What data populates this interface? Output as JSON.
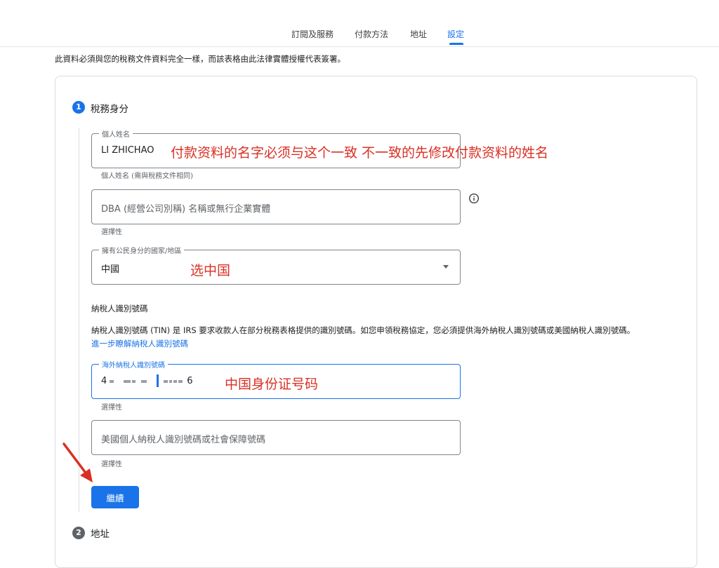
{
  "nav": {
    "tabs": [
      {
        "label": "訂閱及服務"
      },
      {
        "label": "付款方法"
      },
      {
        "label": "地址"
      },
      {
        "label": "設定"
      }
    ],
    "active_tab": "設定"
  },
  "notice": "此資料必須與您的稅務文件資料完全一樣，而該表格由此法律實體授權代表簽署。",
  "steps": [
    {
      "number": "1",
      "title": "稅務身分"
    },
    {
      "number": "2",
      "title": "地址"
    }
  ],
  "fields": {
    "individual_name": {
      "label": "個人姓名",
      "value": "LI ZHICHAO",
      "helper": "個人姓名 (需與稅務文件相同)"
    },
    "dba": {
      "placeholder": "DBA (經營公司別稱) 名稱或無行企業實體",
      "helper": "選擇性"
    },
    "country": {
      "label": "擁有公民身分的國家/地區",
      "value": "中國"
    },
    "tin_section": {
      "title": "納稅人識別號碼",
      "description": "納稅人識別號碼 (TIN) 是 IRS 要求收款人在部分稅務表格提供的識別號碼。如您申領稅務協定，您必須提供海外納稅人識別號碼或美國納稅人識別號碼。",
      "link": "進一步瞭解納稅人識別號碼"
    },
    "foreign_tin": {
      "label": "海外納稅人識別號碼",
      "value_start": "4",
      "value_end": "6",
      "helper": "選擇性"
    },
    "us_tin": {
      "placeholder": "美國個人納稅人識別號碼或社會保障號碼",
      "helper": "選擇性"
    }
  },
  "continue_label": "繼續",
  "annotations": {
    "name_note": "付款资料的名字必须与这个一致 不一致的先修改付款资料的姓名",
    "country_note": "选中国",
    "tin_note": "中国身份证号码"
  },
  "colors": {
    "accent": "#1a73e8",
    "annotation": "#d93025"
  },
  "icons": {
    "info": "info-circle-icon",
    "dropdown": "dropdown-arrow-icon",
    "pointer": "red-arrow-icon"
  }
}
